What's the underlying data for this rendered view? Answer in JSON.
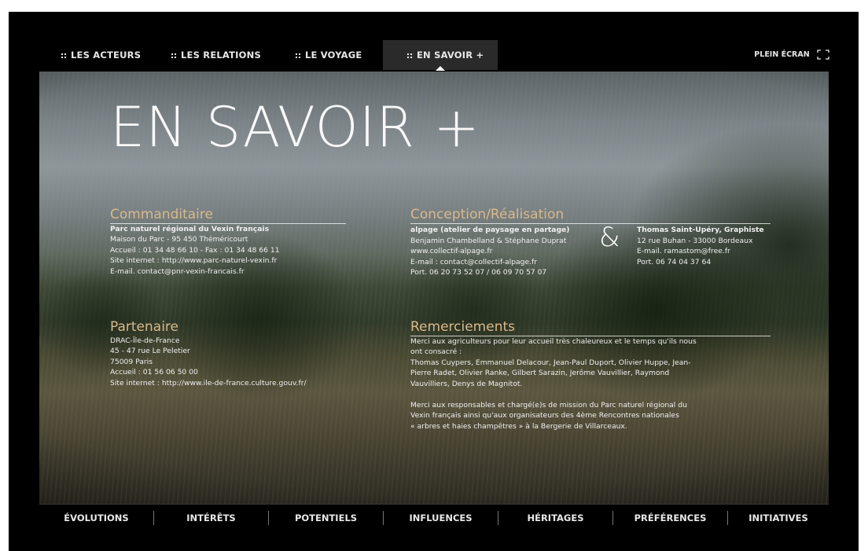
{
  "nav": {
    "tabs": [
      {
        "label": "LES ACTEURS"
      },
      {
        "label": "LES RELATIONS"
      },
      {
        "label": "LE VOYAGE"
      },
      {
        "label": "EN SAVOIR +"
      }
    ],
    "active_tab": "EN SAVOIR +",
    "fullscreen_label": "PLEIN ÉCRAN"
  },
  "hero": {
    "title": "EN SAVOIR +"
  },
  "commanditaire": {
    "heading": "Commanditaire",
    "lines": [
      "Parc naturel régional du Vexin français",
      "Maison du Parc - 95 450 Théméricourt",
      "Accueil : 01 34 48 66 10 - Fax : 01 34 48 66 11",
      "Site internet : http://www.parc-naturel-vexin.fr",
      "E-mail. contact@pnr-vexin-francais.fr"
    ]
  },
  "conception": {
    "heading": "Conception/Réalisation",
    "left_lines": [
      "alpage (atelier de paysage en partage)",
      "Benjamin Chambelland & Stéphane Duprat",
      "www.collectif-alpage.fr",
      "E-mail : contact@collectif-alpage.fr",
      "Port. 06 20 73 52 07 / 06 09 70 57 07"
    ],
    "ampersand": "&",
    "right_lines": [
      "Thomas Saint-Upéry, Graphiste",
      "12 rue Buhan - 33000 Bordeaux",
      "E-mail. ramastom@free.fr",
      "Port. 06 74 04 37 64"
    ]
  },
  "partenaire": {
    "heading": "Partenaire",
    "lines": [
      "DRAC-Île-de-France",
      "45 - 47 rue Le Peletier",
      "75009 Paris",
      "Accueil : 01 56 06 50 00",
      "Site internet : http://www.ile-de-france.culture.gouv.fr/"
    ]
  },
  "remerciements": {
    "heading": "Remerciements",
    "para1_lines": [
      "Merci aux agriculteurs pour leur accueil très chaleureux et le temps qu'ils nous",
      "ont consacré :",
      "Thomas Cuypers, Emmanuel Delacour, Jean-Paul Duport, Olivier Huppe, Jean-",
      "Pierre Radet, Olivier Ranke, Gilbert Sarazin, Jerôme Vauvillier, Raymond",
      "Vauvilliers, Denys de Magnitot."
    ],
    "para2_lines": [
      "Merci aux responsables et chargé(e)s de mission du Parc naturel régional du",
      "Vexin français ainsi qu'aux organisateurs des 4ème Rencontres nationales",
      "« arbres et haies champêtres » à la Bergerie de Villarceaux."
    ]
  },
  "bottom_nav": [
    {
      "label": "ÉVOLUTIONS"
    },
    {
      "label": "INTÉRÊTS"
    },
    {
      "label": "POTENTIELS"
    },
    {
      "label": "INFLUENCES"
    },
    {
      "label": "HÉRITAGES"
    },
    {
      "label": "PRÉFÉRENCES"
    },
    {
      "label": "INITIATIVES"
    }
  ]
}
